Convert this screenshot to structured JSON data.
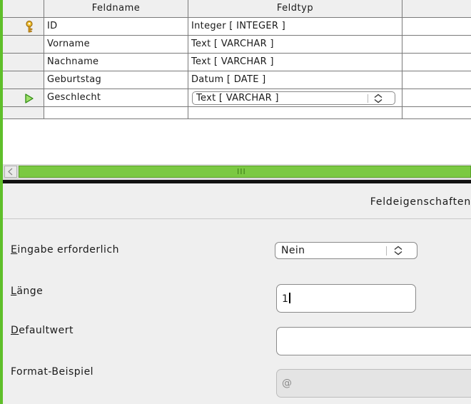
{
  "table": {
    "headers": {
      "field_name": "Feldname",
      "field_type": "Feldtyp"
    },
    "rows": [
      {
        "name": "ID",
        "type": "Integer [ INTEGER ]",
        "marker": "primary-key"
      },
      {
        "name": "Vorname",
        "type": "Text [ VARCHAR ]"
      },
      {
        "name": "Nachname",
        "type": "Text [ VARCHAR ]"
      },
      {
        "name": "Geburtstag",
        "type": "Datum [ DATE ]"
      },
      {
        "name": "Geschlecht",
        "type": "Text [ VARCHAR ]",
        "marker": "current-row",
        "editing": true
      }
    ]
  },
  "scrollbar": {
    "grip": "III"
  },
  "properties": {
    "title": "Feldeigenschaften",
    "required": {
      "mnemonic": "E",
      "rest": "ingabe erforderlich",
      "value": "Nein"
    },
    "length": {
      "mnemonic": "L",
      "rest": "änge",
      "value": "1"
    },
    "default": {
      "mnemonic": "D",
      "rest": "efaultwert",
      "value": ""
    },
    "format": {
      "label": "Format-Beispiel",
      "value": "@"
    }
  },
  "colors": {
    "accent_green": "#7bc942",
    "key_gold": "#e0a020"
  },
  "icons": {
    "primary_key": "key-icon",
    "current_row": "play-arrow-icon",
    "combo_arrow": "updown-arrow-icon",
    "scroll_left": "chevron-left-icon"
  }
}
